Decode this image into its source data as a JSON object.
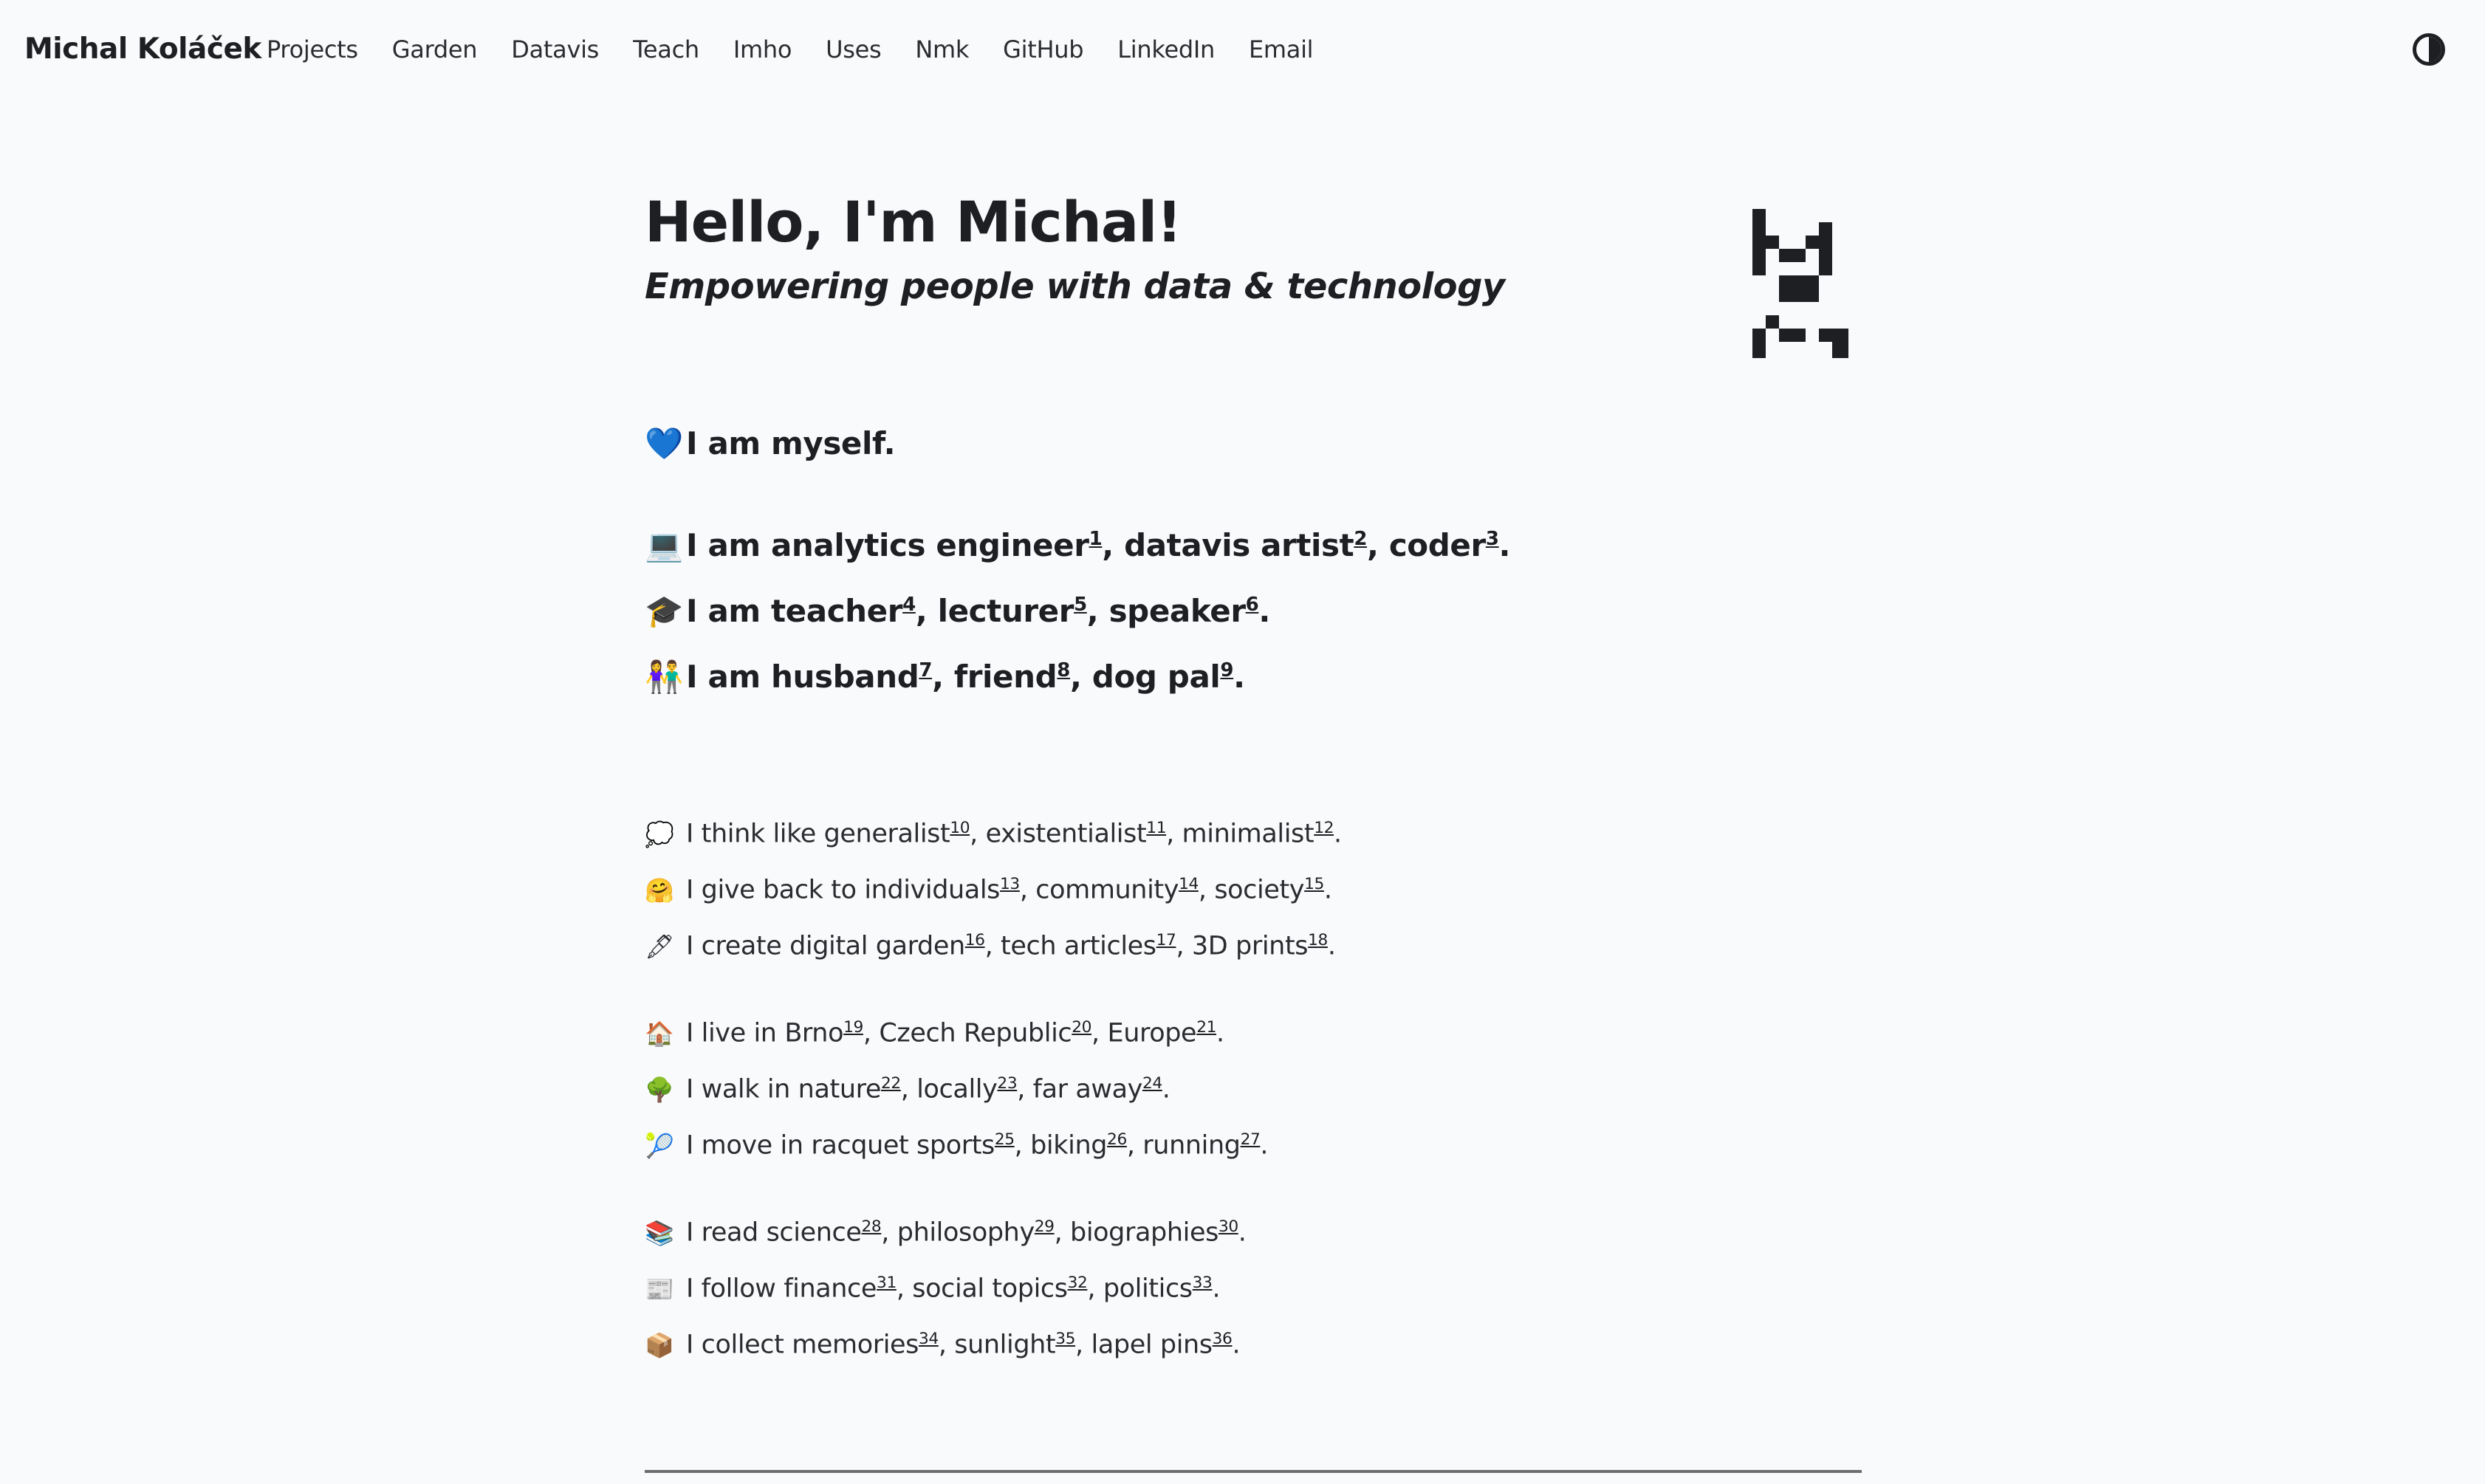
{
  "site": {
    "title": "Michal Koláček"
  },
  "nav": {
    "items": [
      "Projects",
      "Garden",
      "Datavis",
      "Teach",
      "Imho",
      "Uses",
      "Nmk",
      "GitHub",
      "LinkedIn",
      "Email"
    ]
  },
  "theme_toggle": {
    "icon": "contrast-icon"
  },
  "hero": {
    "heading": "Hello, I'm Michal!",
    "tagline": "Empowering people with data & technology"
  },
  "identity": {
    "myself": {
      "emoji": "💙",
      "text": "I am myself."
    },
    "lines": [
      {
        "emoji": "💻",
        "prefix": "I am ",
        "items": [
          {
            "label": "analytics engineer",
            "ref": "1"
          },
          {
            "label": "datavis artist",
            "ref": "2"
          },
          {
            "label": "coder",
            "ref": "3"
          }
        ]
      },
      {
        "emoji": "🎓",
        "prefix": "I am ",
        "items": [
          {
            "label": "teacher",
            "ref": "4"
          },
          {
            "label": "lecturer",
            "ref": "5"
          },
          {
            "label": "speaker",
            "ref": "6"
          }
        ]
      },
      {
        "emoji": "👫",
        "prefix": "I am ",
        "items": [
          {
            "label": "husband",
            "ref": "7"
          },
          {
            "label": "friend",
            "ref": "8"
          },
          {
            "label": "dog pal",
            "ref": "9"
          }
        ]
      }
    ]
  },
  "facts": [
    {
      "emoji": "💭",
      "prefix": "I think like ",
      "items": [
        {
          "label": "generalist",
          "ref": "10"
        },
        {
          "label": "existentialist",
          "ref": "11"
        },
        {
          "label": "minimalist",
          "ref": "12"
        }
      ]
    },
    {
      "emoji": "🤗",
      "prefix": "I give back to ",
      "items": [
        {
          "label": "individuals",
          "ref": "13"
        },
        {
          "label": "community",
          "ref": "14"
        },
        {
          "label": "society",
          "ref": "15"
        }
      ]
    },
    {
      "emoji": "🖋",
      "prefix": "I create ",
      "items": [
        {
          "label": "digital garden",
          "ref": "16"
        },
        {
          "label": "tech articles",
          "ref": "17"
        },
        {
          "label": "3D prints",
          "ref": "18"
        }
      ]
    },
    {
      "emoji": "🏠",
      "prefix": "I live in ",
      "items": [
        {
          "label": "Brno",
          "ref": "19"
        },
        {
          "label": "Czech Republic",
          "ref": "20"
        },
        {
          "label": "Europe",
          "ref": "21"
        }
      ]
    },
    {
      "emoji": "🌳",
      "prefix": "I walk in ",
      "items": [
        {
          "label": "nature",
          "ref": "22"
        },
        {
          "label": "locally",
          "ref": "23"
        },
        {
          "label": "far away",
          "ref": "24"
        }
      ]
    },
    {
      "emoji": "🎾",
      "prefix": "I move in ",
      "items": [
        {
          "label": "racquet sports",
          "ref": "25"
        },
        {
          "label": "biking",
          "ref": "26"
        },
        {
          "label": "running",
          "ref": "27"
        }
      ]
    },
    {
      "emoji": "📚",
      "prefix": "I read ",
      "items": [
        {
          "label": "science",
          "ref": "28"
        },
        {
          "label": "philosophy",
          "ref": "29"
        },
        {
          "label": "biographies",
          "ref": "30"
        }
      ]
    },
    {
      "emoji": "📰",
      "prefix": "I follow ",
      "items": [
        {
          "label": "finance",
          "ref": "31"
        },
        {
          "label": "social topics",
          "ref": "32"
        },
        {
          "label": "politics",
          "ref": "33"
        }
      ]
    },
    {
      "emoji": "📦",
      "prefix": "I collect ",
      "items": [
        {
          "label": "memories",
          "ref": "34"
        },
        {
          "label": "sunlight",
          "ref": "35"
        },
        {
          "label": "lapel pins",
          "ref": "36"
        }
      ]
    }
  ]
}
